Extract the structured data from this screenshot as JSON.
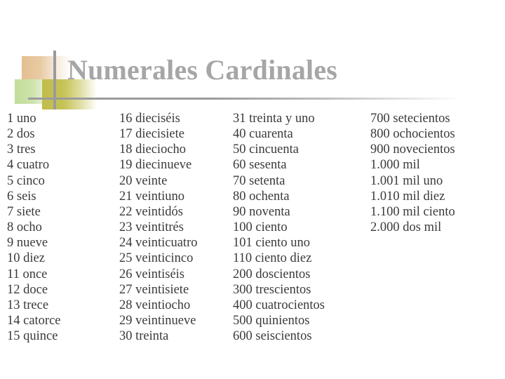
{
  "slide": {
    "title": "Numerales Cardinales",
    "title_color": "#a6a6a6",
    "body_text_color": "#3a3a3a",
    "background_color": "#ffffff"
  },
  "decoration": {
    "tan_block_color": "#e3bf8f",
    "green_block_color": "#c2dd9a",
    "olive_block_color": "#c0bd4a",
    "rule_color": "#9b9b9b"
  },
  "columns": [
    {
      "name": "column-1",
      "entries": [
        "1 uno",
        "2 dos",
        "3 tres",
        "4 cuatro",
        "5 cinco",
        "6 seis",
        "7 siete",
        "8 ocho",
        "9 nueve",
        "10 diez",
        "11 once",
        "12 doce",
        "13 trece",
        "14 catorce",
        "15 quince"
      ]
    },
    {
      "name": "column-2",
      "entries": [
        "16 dieciséis",
        "17 diecisiete",
        "18 dieciocho",
        "19 diecinueve",
        "20 veinte",
        "21 veintiuno",
        "22 veintidós",
        "23 veintitrés",
        "24 veinticuatro",
        "25 veinticinco",
        "26 veintiséis",
        "27 veintisiete",
        "28 veintiocho",
        "29 veintinueve",
        "30 treinta"
      ]
    },
    {
      "name": "column-3",
      "entries": [
        "31 treinta y uno",
        "40 cuarenta",
        "50 cincuenta",
        "60 sesenta",
        "70 setenta",
        "80 ochenta",
        "90 noventa",
        "100 ciento",
        "101 ciento uno",
        "110 ciento diez",
        "200 doscientos",
        "300 trescientos",
        "400 cuatrocientos",
        "500 quinientos",
        "600 seiscientos"
      ]
    },
    {
      "name": "column-4",
      "entries": [
        "700 setecientos",
        "800 ochocientos",
        "900 novecientos",
        "1.000 mil",
        "1.001 mil uno",
        "1.010 mil diez",
        "1.100 mil ciento",
        "2.000 dos mil"
      ]
    }
  ]
}
